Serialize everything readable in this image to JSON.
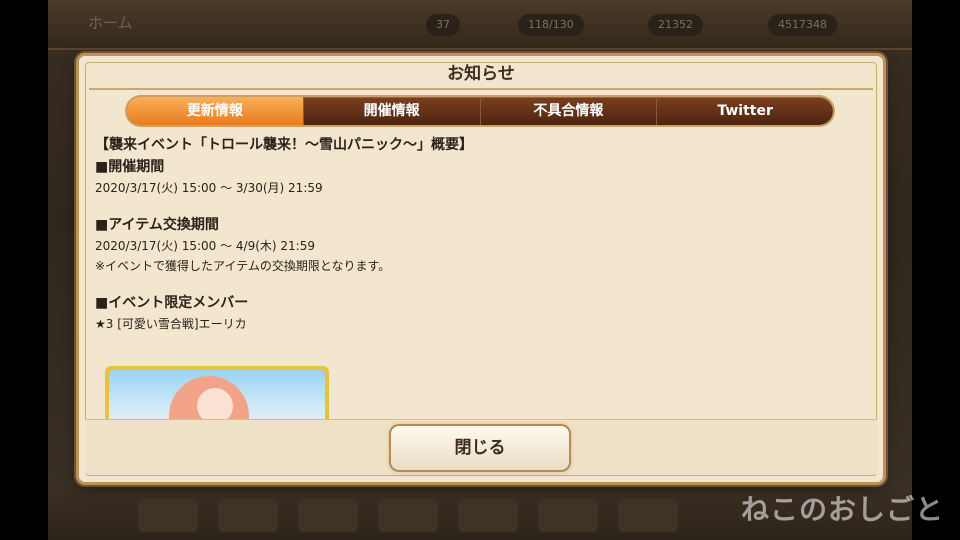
{
  "background": {
    "home_label": "ホーム",
    "resources": [
      "37",
      "118/130",
      "21352",
      "4517348"
    ]
  },
  "modal": {
    "title": "お知らせ",
    "tabs": [
      {
        "label": "更新情報",
        "active": true
      },
      {
        "label": "開催情報",
        "active": false
      },
      {
        "label": "不具合情報",
        "active": false
      },
      {
        "label": "Twitter",
        "active": false
      }
    ],
    "content": {
      "title": "【襲来イベント「トロール襲来！～雪山パニック～」概要】",
      "section1_heading": "■開催期間",
      "section1_line": "2020/3/17(火) 15:00 ～ 3/30(月) 21:59",
      "section2_heading": "■アイテム交換期間",
      "section2_line": "2020/3/17(火) 15:00 ～ 4/9(木) 21:59",
      "section2_note": "※イベントで獲得したアイテムの交換期限となります。",
      "section3_heading": "■イベント限定メンバー",
      "section3_line": "★3 [可愛い雪合戦]エーリカ"
    },
    "close_label": "閉じる"
  },
  "watermark": "ねこのおしごと",
  "colors": {
    "tab_active": "#ea7a1d",
    "tab_bar": "#5a2a14",
    "panel": "#f2e6cf",
    "frame": "#b9935a"
  }
}
